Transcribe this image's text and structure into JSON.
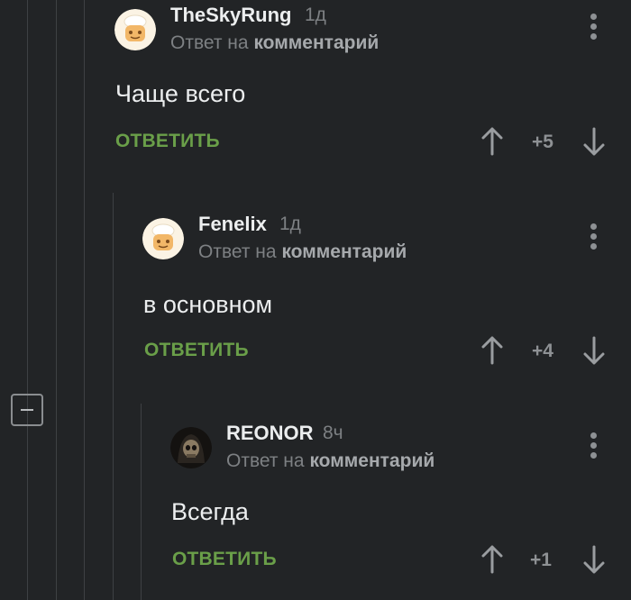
{
  "comments": [
    {
      "username": "TheSkyRung",
      "time": "1д",
      "reply_prefix": "Ответ на",
      "reply_link": "комментарий",
      "text": "Чаще всего",
      "reply_label": "ОТВЕТИТЬ",
      "score": "+5",
      "avatar_icon": "chef-avatar-icon"
    },
    {
      "username": "Fenelix",
      "time": "1д",
      "reply_prefix": "Ответ на",
      "reply_link": "комментарий",
      "text": "в основном",
      "reply_label": "ОТВЕТИТЬ",
      "score": "+4",
      "avatar_icon": "chef-avatar-icon"
    },
    {
      "username": "REONOR",
      "time": "8ч",
      "reply_prefix": "Ответ на",
      "reply_link": "комментарий",
      "text": "Всегда",
      "reply_label": "ОТВЕТИТЬ",
      "score": "+1",
      "avatar_icon": "skull-avatar-icon"
    }
  ],
  "colors": {
    "background": "#222426",
    "reply_green": "#6a9f49",
    "muted": "#7d8083",
    "text": "#eceeef"
  }
}
